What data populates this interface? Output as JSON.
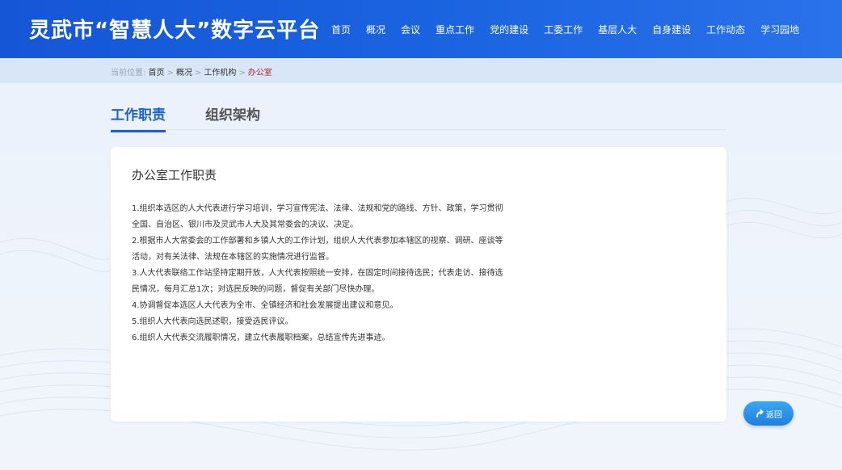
{
  "header": {
    "site_title": "灵武市“智慧人大”数字云平台",
    "nav": [
      {
        "label": "首页"
      },
      {
        "label": "概况"
      },
      {
        "label": "会议"
      },
      {
        "label": "重点工作"
      },
      {
        "label": "党的建设"
      },
      {
        "label": "工委工作"
      },
      {
        "label": "基层人大"
      },
      {
        "label": "自身建设"
      },
      {
        "label": "工作动态"
      },
      {
        "label": "学习园地"
      }
    ]
  },
  "breadcrumb": {
    "prefix": "当前位置:",
    "items": [
      "首页",
      "概况",
      "工作机构"
    ],
    "separator": ">",
    "current": "办公室"
  },
  "tabs": [
    {
      "label": "工作职责",
      "active": true
    },
    {
      "label": "组织架构",
      "active": false
    }
  ],
  "content": {
    "title": "办公室工作职责",
    "lines": [
      "1.组织本选区的人大代表进行学习培训，学习宣传宪法、法律、法规和党的路线、方针、政策，学习贯彻",
      "全国、自治区、银川市及灵武市人大及其常委会的决议、决定。",
      "2.根据市人大常委会的工作部署和乡镇人大的工作计划，组织人大代表参加本辖区的视察、调研、座谈等",
      "活动，对有关法律、法规在本辖区的实施情况进行监督。",
      "3.人大代表联络工作站坚持定期开放，人大代表按照统一安排，在固定时间接待选民；代表走访、接待选",
      "民情况，每月汇总1次；对选民反映的问题，督促有关部门尽快办理。",
      "4.协调督促本选区人大代表为全市、全镇经济和社会发展提出建议和意见。",
      "5.组织人大代表向选民述职，接受选民评议。",
      "6.组织人大代表交流履职情况，建立代表履职档案，总结宣传先进事迹。"
    ]
  },
  "back_button": {
    "label": "返回",
    "icon": "return-arrow-icon"
  },
  "colors": {
    "header_blue": "#1a63e0",
    "accent_blue": "#1c5fcf",
    "current_crumb": "#b22222",
    "back_button": "#2a8fe8"
  }
}
